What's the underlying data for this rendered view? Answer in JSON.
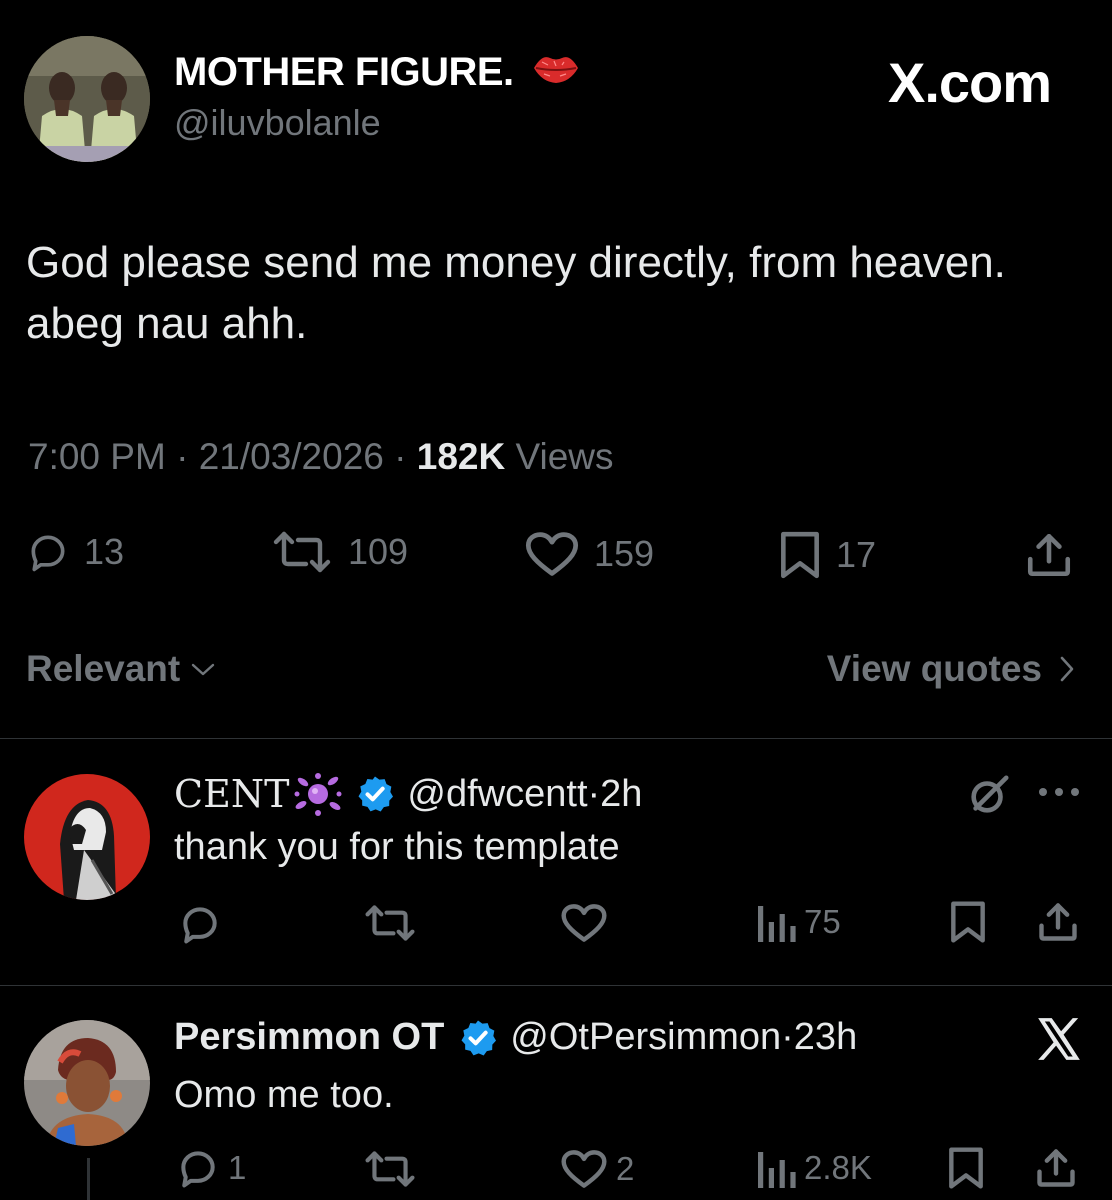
{
  "post": {
    "display_name": "MOTHER FIGURE.",
    "handle": "@iluvbolanle",
    "watermark": "X.com",
    "text": "God please send me money directly, from heaven. abeg nau ahh.",
    "time": "7:00 PM",
    "date": "21/03/2026",
    "views_count": "182K",
    "views_label": "Views",
    "replies": "13",
    "reposts": "109",
    "likes": "159",
    "bookmarks": "17"
  },
  "sort": {
    "label": "Relevant",
    "view_quotes": "View quotes"
  },
  "replies": [
    {
      "display_name": "CENT",
      "handle": "@dfwcentt",
      "time": "2h",
      "text": "thank you for this template",
      "views": "75"
    },
    {
      "display_name": "Persimmon OT",
      "handle": "@OtPersimmon",
      "time": "23h",
      "text": "Omo me too.",
      "replies": "1",
      "likes": "2",
      "views": "2.8K"
    }
  ],
  "colors": {
    "background": "#000000",
    "text": "#e7e9ea",
    "muted": "#71767b",
    "divider": "#2f3336",
    "verified": "#1d9bf0",
    "lips": "#d92b2b"
  }
}
